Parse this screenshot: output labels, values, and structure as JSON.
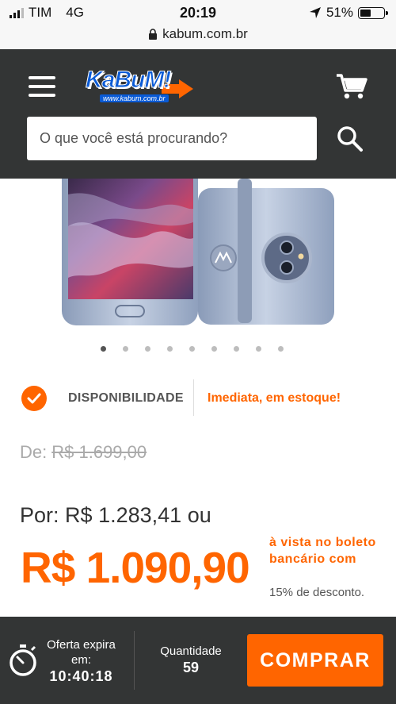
{
  "status_bar": {
    "carrier": "TIM",
    "network": "4G",
    "time": "20:19",
    "battery": "51%",
    "battery_level": 0.51,
    "url": "kabum.com.br"
  },
  "header": {
    "logo_text": "KaBuM!",
    "logo_subtext": "www.kabum.com.br",
    "search_placeholder": "O que você está procurando?",
    "brand_color": "#ff6500",
    "background": "#333535"
  },
  "gallery": {
    "image_count": 9,
    "active_index": 0
  },
  "availability": {
    "label": "DISPONIBILIDADE",
    "value": "Imediata, em estoque!"
  },
  "pricing": {
    "old_label": "De:",
    "old_price": "R$ 1.699,00",
    "por_label": "Por:",
    "por_price": "R$ 1.283,41",
    "ou": "ou",
    "cash_price": "R$ 1.090,90",
    "cash_note": "à vista no boleto bancário com",
    "discount_note": "15% de desconto."
  },
  "footer": {
    "offer_label": "Oferta expira em:",
    "offer_time": "10:40:18",
    "quantity_label": "Quantidade",
    "quantity_value": "59",
    "buy_label": "COMPRAR"
  }
}
